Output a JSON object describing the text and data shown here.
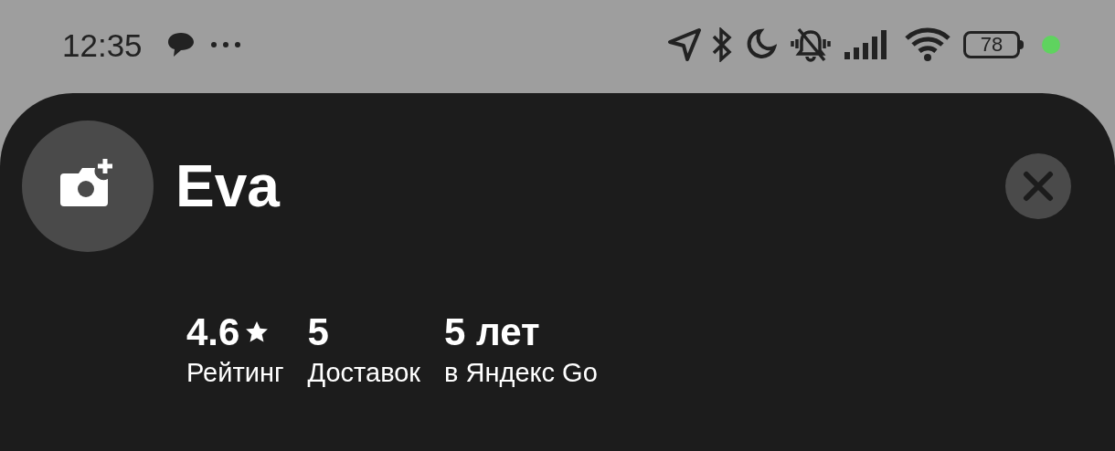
{
  "status_bar": {
    "time": "12:35",
    "battery": "78"
  },
  "profile": {
    "name": "Eva"
  },
  "stats": [
    {
      "kind": "rating",
      "value": "4.6",
      "label": "Рейтинг"
    },
    {
      "kind": "count",
      "value": "5",
      "label": "Доставок"
    },
    {
      "kind": "count",
      "value": "5 лет",
      "label": "в Яндекс Go"
    }
  ]
}
